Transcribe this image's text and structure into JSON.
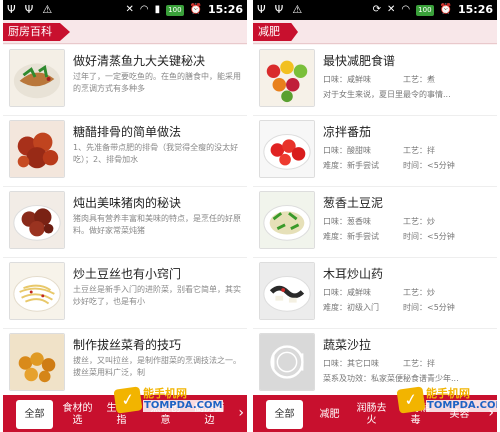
{
  "status_bar": {
    "time": "15:26",
    "battery": "100"
  },
  "left_screen": {
    "category": "厨房百科",
    "items": [
      {
        "title": "做好清蒸鱼九大关键秘决",
        "desc": "过年了，一定要吃鱼的。在鱼的膳食中，能采用的烹调方式有多种多",
        "thumb": "fish-dish-thumbnail"
      },
      {
        "title": "糖醋排骨的简单做法",
        "desc": "1、先准备带点肥的排骨（我觉得全瘦的没太好吃）；2、排骨加水",
        "thumb": "ribs-dish-thumbnail"
      },
      {
        "title": "炖出美味猪肉的秘诀",
        "desc": "猪肉具有营养丰富和美味的特点，是烹任的好原料。做好家常菜炖猪",
        "thumb": "pork-dish-thumbnail"
      },
      {
        "title": "炒土豆丝也有小窍门",
        "desc": "土豆丝是新手入门的进阶菜，别看它简单，其实炒好吃了，也是有小",
        "thumb": "potato-shreds-thumbnail"
      },
      {
        "title": "制作拔丝菜肴的技巧",
        "desc": "拔丝，又叫拉丝，是制作甜菜的烹调技法之一。拔丝菜用料广泛，制",
        "thumb": "candied-dish-thumbnail"
      }
    ],
    "tabs": [
      "全部",
      "食材的选",
      "生鲜炒指",
      "烹饪创意",
      "厨房面边"
    ]
  },
  "right_screen": {
    "category": "减肥",
    "items": [
      {
        "title": "最快减肥食谱",
        "taste": "口味：咸鲜味",
        "craft": "工艺：煮",
        "desc": "对于女生来说，夏日里最令的事情...",
        "thumb": "fruit-bowl-thumbnail"
      },
      {
        "title": "凉拌番茄",
        "taste": "口味：酸甜味",
        "craft": "工艺：拌",
        "difficulty": "难度：新手尝试",
        "time": "时间：<5分钟",
        "thumb": "tomato-salad-thumbnail"
      },
      {
        "title": "葱香土豆泥",
        "taste": "口味：葱香味",
        "craft": "工艺：炒",
        "difficulty": "难度：新手尝试",
        "time": "时间：<5分钟",
        "thumb": "mashed-potato-thumbnail"
      },
      {
        "title": "木耳炒山药",
        "taste": "口味：咸鲜味",
        "craft": "工艺：炒",
        "difficulty": "难度：初级入门",
        "time": "时间：<5分钟",
        "thumb": "fungus-yam-thumbnail"
      },
      {
        "title": "蔬菜沙拉",
        "taste": "口味：其它口味",
        "craft": "工艺：拌",
        "desc": "菜系及功效：私家菜便秘食谱青少年...",
        "thumb": "placeholder-plate-thumbnail"
      }
    ],
    "tabs": [
      "全部",
      "减肥",
      "润肠去火",
      "排毒解毒",
      "美容"
    ]
  },
  "watermark": {
    "cn": "能手机网",
    "en": "TOMPDA.COM"
  }
}
